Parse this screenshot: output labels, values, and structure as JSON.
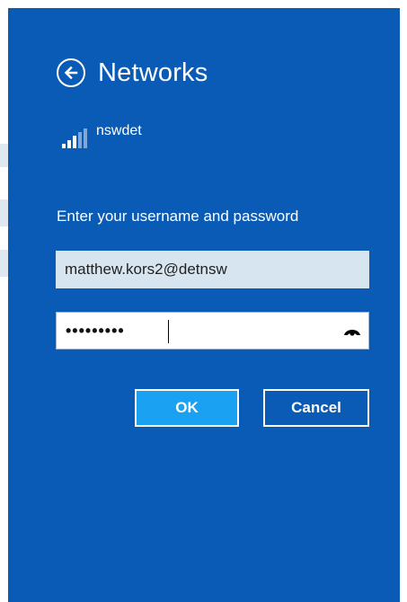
{
  "header": {
    "title": "Networks",
    "back_icon": "back-arrow-circle-icon"
  },
  "network": {
    "name": "nswdet",
    "signal_icon": "wifi-signal-icon"
  },
  "form": {
    "prompt": "Enter your username and password",
    "username_value": "matthew.kors2@detnsw",
    "password_value": "•••••••••",
    "reveal_icon": "reveal-password-icon"
  },
  "buttons": {
    "ok_label": "OK",
    "cancel_label": "Cancel"
  },
  "colors": {
    "panel_background": "#0a5bb6",
    "ok_button": "#1aa1f1",
    "username_field": "#d7e5f0"
  }
}
